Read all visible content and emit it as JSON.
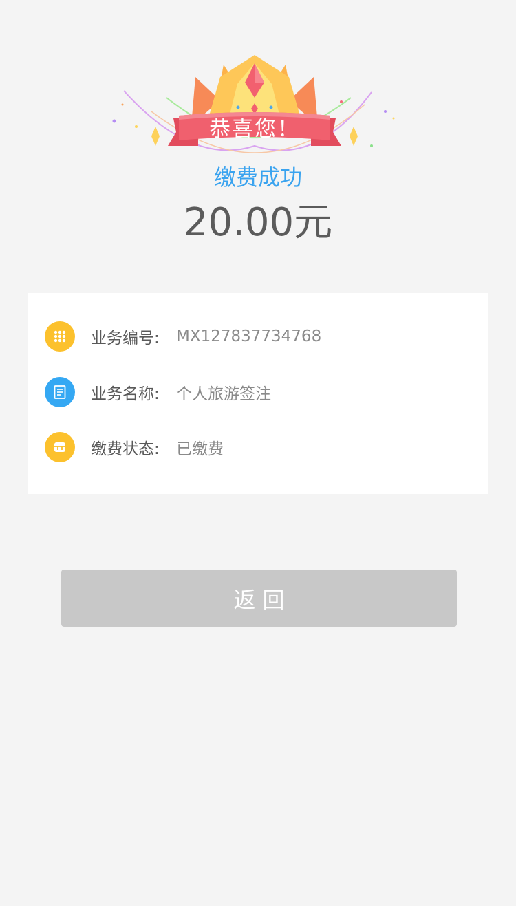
{
  "banner": {
    "ribbon_text": "恭喜您！"
  },
  "status": {
    "title": "缴费成功",
    "amount": "20.00元"
  },
  "details": {
    "rows": [
      {
        "icon": "keypad-icon",
        "icon_color": "#fcc12d",
        "label": "业务编号:",
        "value": "MX127837734768"
      },
      {
        "icon": "document-icon",
        "icon_color": "#35a8f3",
        "label": "业务名称:",
        "value": "个人旅游签注"
      },
      {
        "icon": "wallet-icon",
        "icon_color": "#fcc12d",
        "label": "缴费状态:",
        "value": "已缴费"
      }
    ]
  },
  "actions": {
    "back_label": "返回"
  },
  "colors": {
    "background": "#f4f4f4",
    "accent_blue": "#3aa3ef",
    "icon_yellow": "#fcc12d",
    "icon_blue": "#35a8f3",
    "button_gray": "#c8c8c8",
    "ribbon_red": "#f0606e"
  }
}
